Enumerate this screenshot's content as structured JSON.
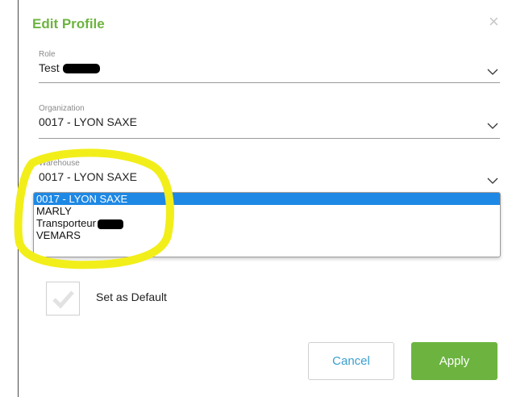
{
  "modal": {
    "title": "Edit Profile",
    "close_icon": "×"
  },
  "role": {
    "label": "Role",
    "value": "Test"
  },
  "organization": {
    "label": "Organization",
    "value": "0017 - LYON SAXE"
  },
  "warehouse": {
    "label": "Warehouse",
    "value": "0017 - LYON SAXE",
    "options": [
      "0017 - LYON SAXE",
      "MARLY",
      "Transporteur",
      "VEMARS"
    ],
    "selected_index": 0
  },
  "default_checkbox": {
    "label": "Set as Default",
    "checked": false
  },
  "buttons": {
    "cancel": "Cancel",
    "apply": "Apply"
  },
  "colors": {
    "accent": "#6cb43f",
    "selection": "#1e88e5",
    "highlight": "#f2ee1a"
  },
  "icons": {
    "close": "close-icon",
    "chevron": "chevron-down-icon",
    "check": "checkmark-icon"
  }
}
